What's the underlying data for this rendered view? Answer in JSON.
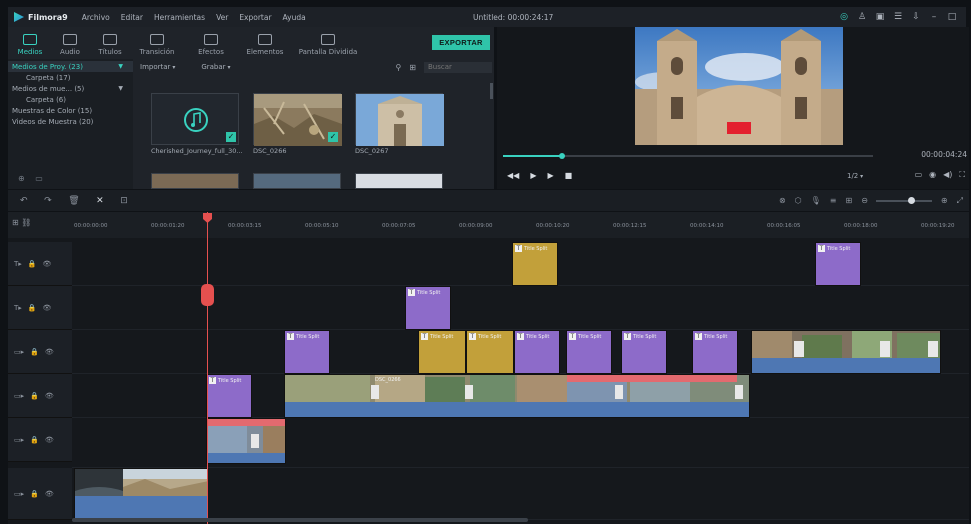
{
  "app": {
    "name": "Filmora9",
    "menu": [
      "Archivo",
      "Editar",
      "Herramientas",
      "Ver",
      "Exportar",
      "Ayuda"
    ],
    "project_title": "Untitled: 00:00:24:17"
  },
  "media": {
    "tabs": [
      "Medios",
      "Audio",
      "Títulos",
      "Transición",
      "Efectos",
      "Elementos",
      "Pantalla Dividida"
    ],
    "export_label": "EXPORTAR",
    "library": [
      {
        "label": "Medios de Proy. (23)",
        "active": true
      },
      {
        "label": "Carpeta (17)",
        "sub": true
      },
      {
        "label": "Medios de mue... (5)",
        "sub": false
      },
      {
        "label": "Carpeta (6)",
        "sub": true
      },
      {
        "label": "Muestras de Color (15)",
        "sub": false
      },
      {
        "label": "Videos de Muestra (20)",
        "sub": false
      }
    ],
    "import_label": "Importar",
    "record_label": "Grabar",
    "search_placeholder": "Buscar",
    "items": [
      {
        "label": "Cherished_Journey_full_30..."
      },
      {
        "label": "DSC_0266"
      },
      {
        "label": "DSC_0267"
      }
    ]
  },
  "preview": {
    "timecode": "00:00:04:24",
    "quality": "1/2",
    "progress": 0.16
  },
  "timeline": {
    "ticks": [
      "00:00:00:00",
      "00:00:01:20",
      "00:00:03:15",
      "00:00:05:10",
      "00:00:07:05",
      "00:00:09:00",
      "00:00:10:20",
      "00:00:12:15",
      "00:00:14:10",
      "00:00:16:05",
      "00:00:18:00",
      "00:00:19:20"
    ],
    "title_clip_label": "Title Split",
    "video_clip_label": "DSC_0266"
  }
}
